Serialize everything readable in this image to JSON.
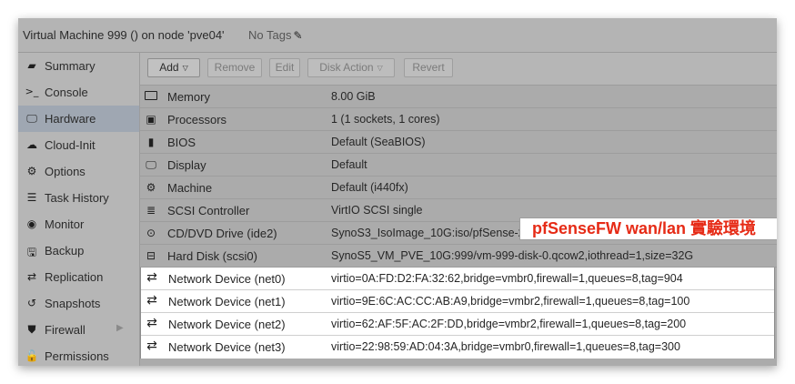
{
  "window": {
    "title": "Virtual Machine 999 () on node 'pve04'",
    "tags_label": "No Tags"
  },
  "sidebar": {
    "items": [
      {
        "label": "Summary",
        "icon": "book-icon",
        "active": false
      },
      {
        "label": "Console",
        "icon": "terminal-icon",
        "active": false
      },
      {
        "label": "Hardware",
        "icon": "monitor-icon",
        "active": true
      },
      {
        "label": "Cloud-Init",
        "icon": "cloud-icon",
        "active": false
      },
      {
        "label": "Options",
        "icon": "gear-icon",
        "active": false
      },
      {
        "label": "Task History",
        "icon": "list-icon",
        "active": false
      },
      {
        "label": "Monitor",
        "icon": "eye-icon",
        "active": false
      },
      {
        "label": "Backup",
        "icon": "floppy-icon",
        "active": false
      },
      {
        "label": "Replication",
        "icon": "retweet-icon",
        "active": false
      },
      {
        "label": "Snapshots",
        "icon": "history-icon",
        "active": false
      },
      {
        "label": "Firewall",
        "icon": "shield-icon",
        "active": false
      },
      {
        "label": "Permissions",
        "icon": "unlock-icon",
        "active": false
      }
    ]
  },
  "toolbar": {
    "add_label": "Add",
    "remove_label": "Remove",
    "edit_label": "Edit",
    "disk_action_label": "Disk Action",
    "revert_label": "Revert"
  },
  "hardware": {
    "rows": [
      {
        "name": "Memory",
        "value": "8.00 GiB",
        "icon": "memory-icon"
      },
      {
        "name": "Processors",
        "value": "1 (1 sockets, 1 cores)",
        "icon": "cpu-icon"
      },
      {
        "name": "BIOS",
        "value": "Default (SeaBIOS)",
        "icon": "microchip-icon"
      },
      {
        "name": "Display",
        "value": "Default",
        "icon": "desktop-icon"
      },
      {
        "name": "Machine",
        "value": "Default (i440fx)",
        "icon": "cogs-icon"
      },
      {
        "name": "SCSI Controller",
        "value": "VirtIO SCSI single",
        "icon": "database-icon"
      },
      {
        "name": "CD/DVD Drive (ide2)",
        "value": "SynoS3_IsoImage_10G:iso/pfSense-2.6.0-amd64.iso,media=cdrom,size=749476K",
        "icon": "cdrom-icon"
      },
      {
        "name": "Hard Disk (scsi0)",
        "value": "SynoS5_VM_PVE_10G:999/vm-999-disk-0.qcow2,iothread=1,size=32G",
        "icon": "hdd-icon"
      },
      {
        "name": "Network Device (net0)",
        "value": "virtio=0A:FD:D2:FA:32:62,bridge=vmbr0,firewall=1,queues=8,tag=904",
        "icon": "exchange-icon"
      },
      {
        "name": "Network Device (net1)",
        "value": "virtio=9E:6C:AC:CC:AB:A9,bridge=vmbr2,firewall=1,queues=8,tag=100",
        "icon": "exchange-icon"
      },
      {
        "name": "Network Device (net2)",
        "value": "virtio=62:AF:5F:AC:2F:DD,bridge=vmbr2,firewall=1,queues=8,tag=200",
        "icon": "exchange-icon"
      },
      {
        "name": "Network Device (net3)",
        "value": "virtio=22:98:59:AD:04:3A,bridge=vmbr0,firewall=1,queues=8,tag=300",
        "icon": "exchange-icon"
      }
    ]
  },
  "annotation": {
    "text": "pfSenseFW wan/lan 實驗環境",
    "color": "#e62b16"
  },
  "colors": {
    "active_nav": "#9fa7b2",
    "panel_gray": "#b6b6b6"
  }
}
